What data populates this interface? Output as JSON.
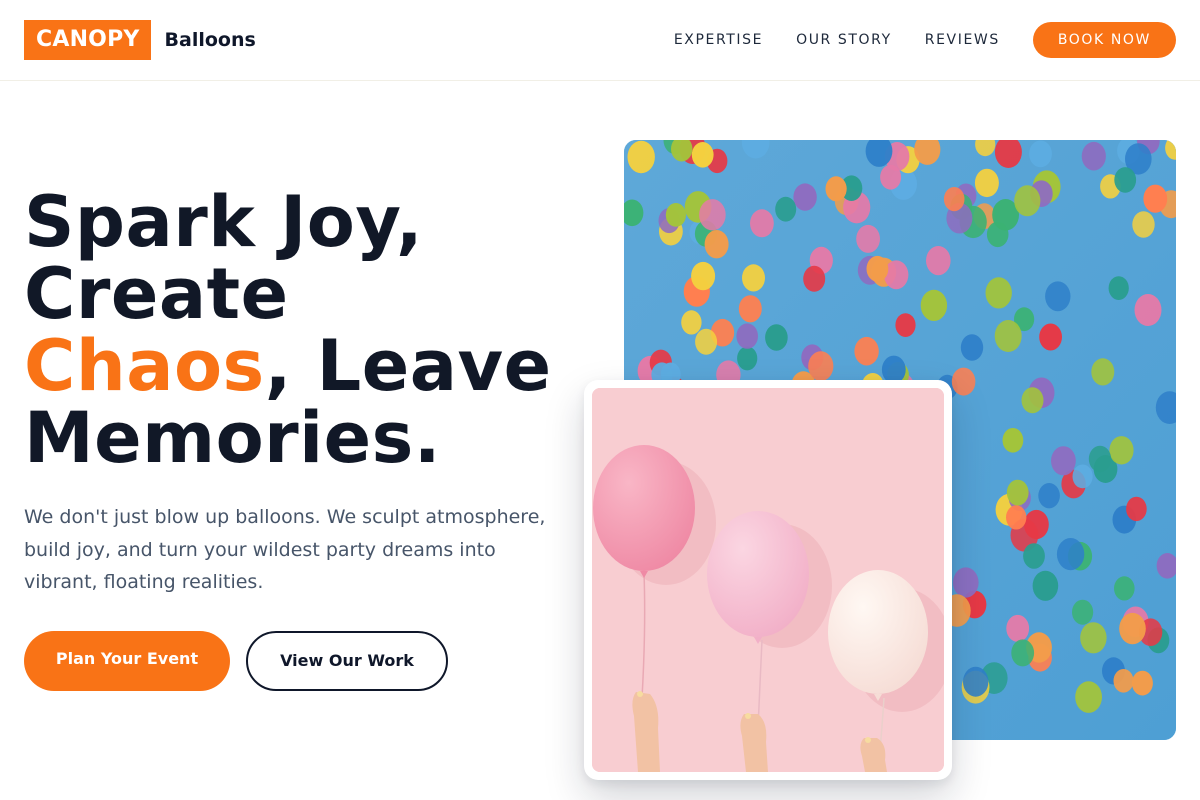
{
  "brand": {
    "logo_box": "CANOPY",
    "logo_text": "Balloons",
    "accent_color": "#f97316"
  },
  "nav": {
    "items": [
      "EXPERTISE",
      "OUR STORY",
      "REVIEWS"
    ],
    "cta": "BOOK NOW"
  },
  "hero": {
    "headline_1": "Spark Joy,",
    "headline_2": "Create",
    "headline_accent": "Chaos",
    "headline_3": ", Leave",
    "headline_4": "Memories.",
    "subtext": "We don't just blow up balloons. We sculpt atmosphere, build joy, and turn your wildest party dreams into vibrant, floating realities.",
    "primary_button": "Plan Your Event",
    "secondary_button": "View Our Work"
  },
  "images": {
    "main_icon": "colorful-balloons-sky-photo",
    "card_icon": "pink-balloons-hands-photo"
  }
}
